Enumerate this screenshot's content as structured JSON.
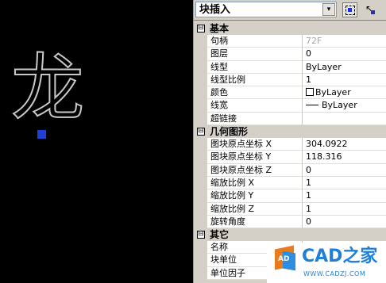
{
  "drawing": {
    "glyph_text": "龙"
  },
  "toolbar": {
    "block_type": "块插入",
    "dropdown_arrow": "▾"
  },
  "sections": {
    "basic": {
      "title": "基本",
      "rows": [
        {
          "name": "句柄",
          "value": "72F"
        },
        {
          "name": "图层",
          "value": "0"
        },
        {
          "name": "线型",
          "value": "ByLayer"
        },
        {
          "name": "线型比例",
          "value": "1"
        },
        {
          "name": "颜色",
          "value": "ByLayer"
        },
        {
          "name": "线宽",
          "value": "ByLayer"
        },
        {
          "name": "超链接",
          "value": ""
        }
      ]
    },
    "geometry": {
      "title": "几何图形",
      "rows": [
        {
          "name": "图块原点坐标 X",
          "value": "304.0922"
        },
        {
          "name": "图块原点坐标 Y",
          "value": "118.316"
        },
        {
          "name": "图块原点坐标 Z",
          "value": "0"
        },
        {
          "name": "缩放比例 X",
          "value": "1"
        },
        {
          "name": "缩放比例 Y",
          "value": "1"
        },
        {
          "name": "缩放比例 Z",
          "value": "1"
        },
        {
          "name": "旋转角度",
          "value": "0"
        }
      ]
    },
    "other": {
      "title": "其它",
      "rows": [
        {
          "name": "名称",
          "value": "^"
        },
        {
          "name": "块单位",
          "value": ""
        },
        {
          "name": "单位因子",
          "value": ""
        }
      ]
    }
  },
  "collapse_symbol": "⊟",
  "watermark": {
    "title": "CAD之家",
    "url": "WWW.CADZJ.COM",
    "badge": "AD"
  },
  "colors": {
    "grip": "#1f3fd6",
    "panel_bg": "#d4d0c8",
    "logo_blue": "#1f7fd6"
  }
}
